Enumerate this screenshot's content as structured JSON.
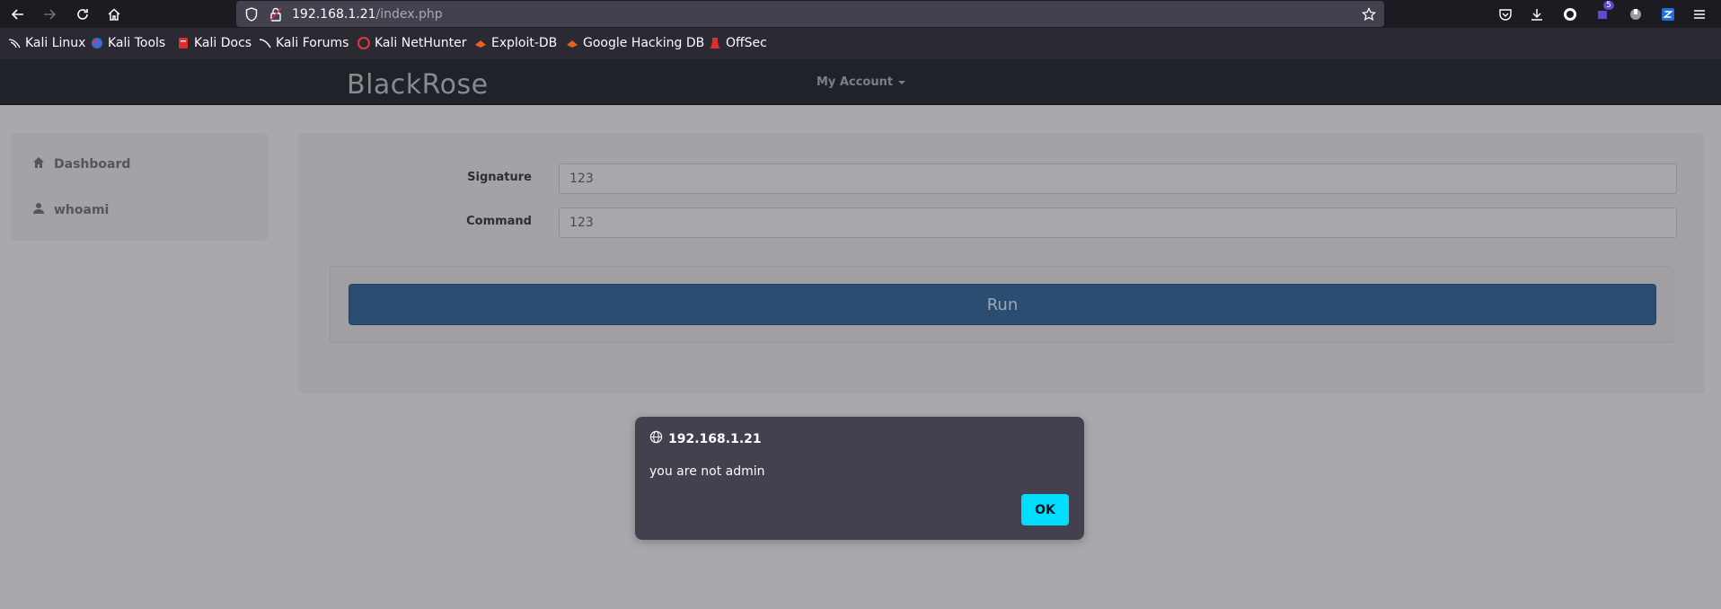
{
  "browser": {
    "url_host": "192.168.1.21",
    "url_path": "/index.php",
    "extension_badge": "5",
    "bookmarks": [
      {
        "label": "Kali Linux",
        "icon": "kali-dragon-icon"
      },
      {
        "label": "Kali Tools",
        "icon": "kali-tools-icon"
      },
      {
        "label": "Kali Docs",
        "icon": "kali-docs-icon"
      },
      {
        "label": "Kali Forums",
        "icon": "kali-forums-icon"
      },
      {
        "label": "Kali NetHunter",
        "icon": "nethunter-icon"
      },
      {
        "label": "Exploit-DB",
        "icon": "exploit-db-icon"
      },
      {
        "label": "Google Hacking DB",
        "icon": "ghdb-icon"
      },
      {
        "label": "OffSec",
        "icon": "offsec-icon"
      }
    ]
  },
  "app": {
    "brand": "BlackRose",
    "account_menu": "My Account"
  },
  "sidebar": {
    "items": [
      {
        "label": "Dashboard",
        "icon": "home-icon"
      },
      {
        "label": "whoami",
        "icon": "user-icon"
      }
    ]
  },
  "form": {
    "signature_label": "Signature",
    "signature_value": "123",
    "command_label": "Command",
    "command_value": "123",
    "run_label": "Run"
  },
  "dialog": {
    "origin": "192.168.1.21",
    "message": "you are not admin",
    "ok_label": "OK"
  },
  "colors": {
    "ok_button": "#00ddff",
    "run_button": "#2b4d72",
    "navbar": "#1f2228"
  }
}
